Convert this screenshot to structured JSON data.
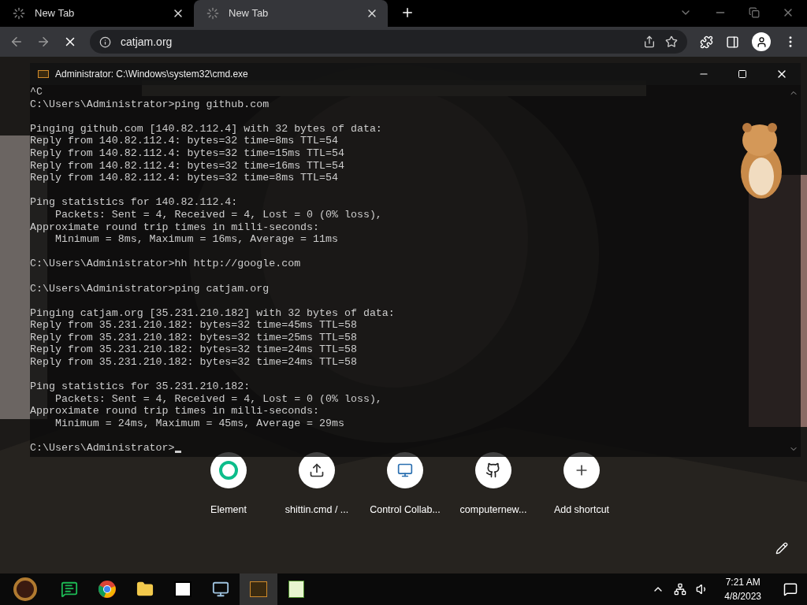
{
  "tabs": [
    {
      "title": "New Tab",
      "selected": false
    },
    {
      "title": "New Tab",
      "selected": true
    }
  ],
  "address": "catjam.org",
  "terminal": {
    "title": "Administrator: C:\\Windows\\system32\\cmd.exe",
    "blocks": [
      [
        "^C",
        "C:\\Users\\Administrator>ping github.com"
      ],
      [
        "Pinging github.com [140.82.112.4] with 32 bytes of data:",
        "Reply from 140.82.112.4: bytes=32 time=8ms TTL=54",
        "Reply from 140.82.112.4: bytes=32 time=15ms TTL=54",
        "Reply from 140.82.112.4: bytes=32 time=16ms TTL=54",
        "Reply from 140.82.112.4: bytes=32 time=8ms TTL=54"
      ],
      [
        "Ping statistics for 140.82.112.4:",
        "    Packets: Sent = 4, Received = 4, Lost = 0 (0% loss),",
        "Approximate round trip times in milli-seconds:",
        "    Minimum = 8ms, Maximum = 16ms, Average = 11ms"
      ],
      [
        "C:\\Users\\Administrator>hh http://google.com"
      ],
      [
        "C:\\Users\\Administrator>ping catjam.org"
      ],
      [
        "Pinging catjam.org [35.231.210.182] with 32 bytes of data:",
        "Reply from 35.231.210.182: bytes=32 time=45ms TTL=58",
        "Reply from 35.231.210.182: bytes=32 time=25ms TTL=58",
        "Reply from 35.231.210.182: bytes=32 time=24ms TTL=58",
        "Reply from 35.231.210.182: bytes=32 time=24ms TTL=58"
      ],
      [
        "Ping statistics for 35.231.210.182:",
        "    Packets: Sent = 4, Received = 4, Lost = 0 (0% loss),",
        "Approximate round trip times in milli-seconds:",
        "    Minimum = 24ms, Maximum = 45ms, Average = 29ms"
      ],
      [
        "C:\\Users\\Administrator>"
      ]
    ]
  },
  "shortcuts": [
    {
      "label": "Element",
      "kind": "element"
    },
    {
      "label": "shittin.cmd / ...",
      "kind": "upload"
    },
    {
      "label": "Control Collab...",
      "kind": "monitor"
    },
    {
      "label": "computernew...",
      "kind": "github"
    },
    {
      "label": "Add shortcut",
      "kind": "add"
    }
  ],
  "taskbar": {
    "apps": [
      {
        "kind": "chat",
        "active": false
      },
      {
        "kind": "chrome",
        "active": false
      },
      {
        "kind": "folder",
        "active": false
      },
      {
        "kind": "zip",
        "active": false
      },
      {
        "kind": "monitor",
        "active": false
      },
      {
        "kind": "cmd",
        "active": true
      },
      {
        "kind": "notepad",
        "active": false
      }
    ],
    "time": "7:21 AM",
    "date": "4/8/2023"
  }
}
